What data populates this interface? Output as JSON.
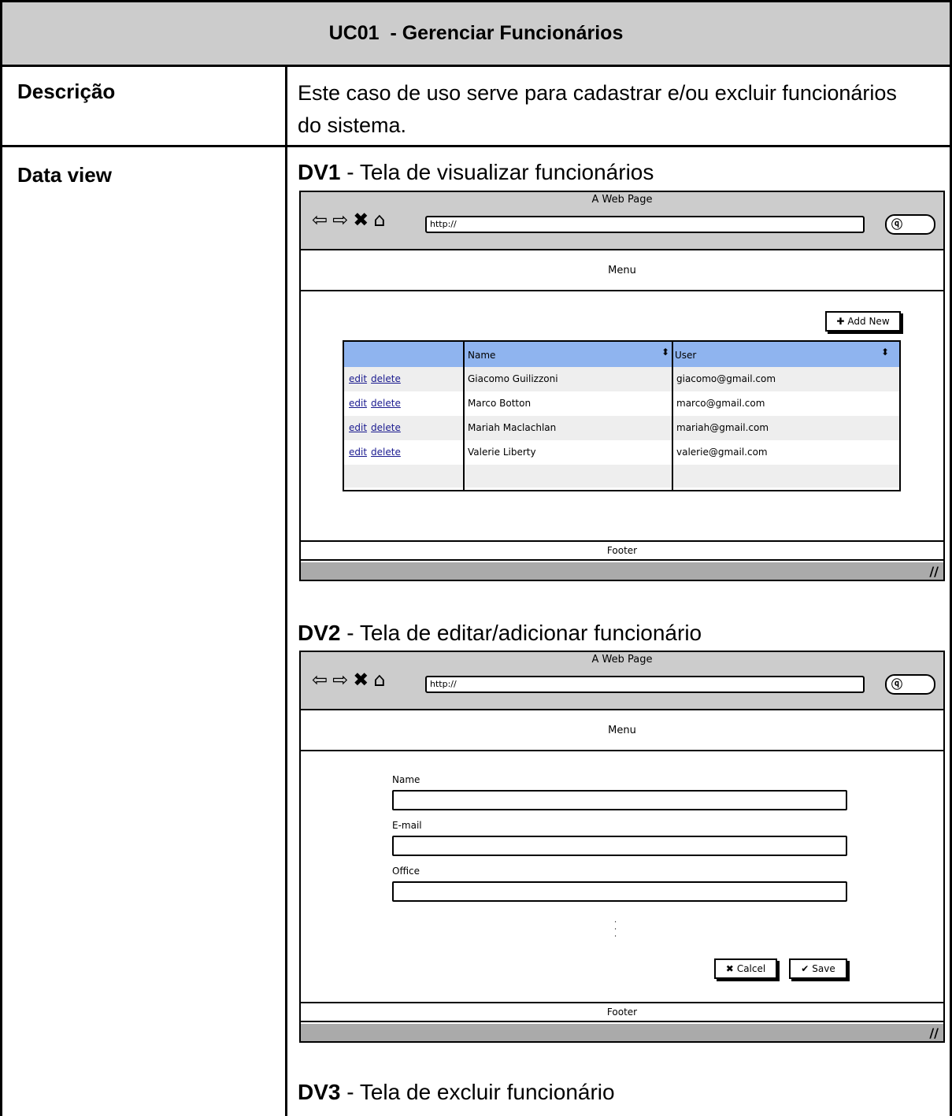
{
  "doc": {
    "title": "UC01  - Gerenciar Funcionários",
    "rows": {
      "description_label": "Descrição",
      "description_text": "Este caso de uso serve para cadastrar e/ou excluir funcionários do sistema.",
      "dataview_label": "Data view"
    },
    "dv1": {
      "code": "DV1",
      "text": " - Tela de visualizar funcionários"
    },
    "dv2": {
      "code": "DV2",
      "text": " - Tela de editar/adicionar funcionário"
    },
    "dv3": {
      "code": "DV3",
      "text": " - Tela de excluir funcionário"
    }
  },
  "mockup1": {
    "window_title": "A Web Page",
    "url": "http://",
    "menu": "Menu",
    "footer": "Footer",
    "add_new_label": "Add New",
    "grid": {
      "headers": [
        "",
        "Name",
        "User"
      ],
      "rows": [
        {
          "edit": "edit",
          "delete": "delete",
          "name": "Giacomo Guilizzoni",
          "user": "giacomo@gmail.com"
        },
        {
          "edit": "edit",
          "delete": "delete",
          "name": "Marco Botton",
          "user": "marco@gmail.com"
        },
        {
          "edit": "edit",
          "delete": "delete",
          "name": "Mariah Maclachlan",
          "user": "mariah@gmail.com"
        },
        {
          "edit": "edit",
          "delete": "delete",
          "name": "Valerie Liberty",
          "user": "valerie@gmail.com"
        }
      ]
    }
  },
  "mockup2": {
    "window_title": "A Web Page",
    "url": "http://",
    "menu": "Menu",
    "footer": "Footer",
    "fields": [
      {
        "label": "Name",
        "value": ""
      },
      {
        "label": "E-mail",
        "value": ""
      },
      {
        "label": "Office",
        "value": ""
      }
    ],
    "cancel_label": "Calcel",
    "save_label": "Save"
  },
  "icons": {
    "back": "back-arrow-icon",
    "forward": "forward-arrow-icon",
    "stop": "stop-x-icon",
    "home": "home-icon",
    "search": "search-icon",
    "plus": "plus-icon",
    "cancel": "x-icon",
    "save": "check-icon",
    "sort": "sort-icon",
    "resize": "resize-grip-icon"
  },
  "colors": {
    "title_row_bg": "#cccccc",
    "grid_header_bg": "#8fb4ef",
    "window_chrome": "#cccccc",
    "status_bar": "#aaaaaa"
  }
}
